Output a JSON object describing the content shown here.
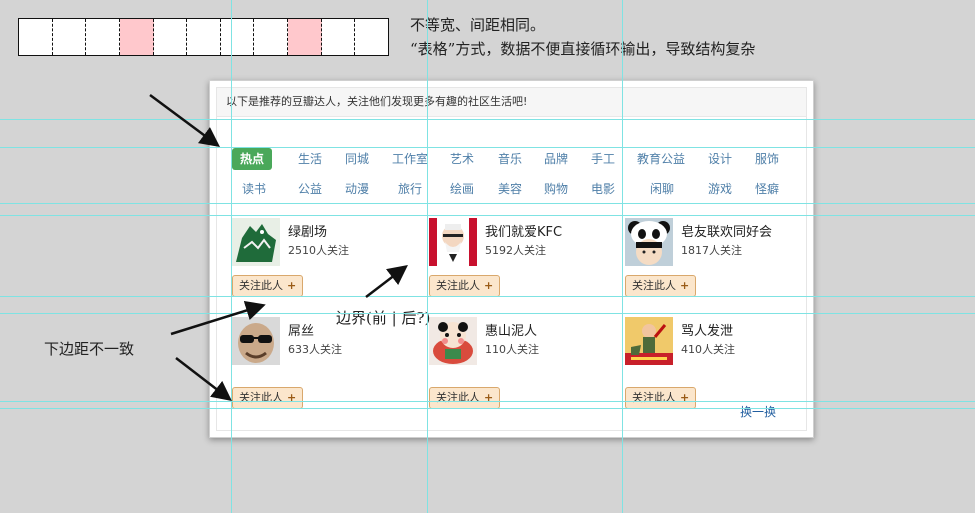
{
  "annotations": {
    "top_note_line1": "不等宽、间距相同。",
    "top_note_line2": "“表格”方式，数据不便直接循环输出，导致结构复杂",
    "left_note": "下边距不一致",
    "border_note": "边界(前 | 后?)"
  },
  "panel": {
    "intro": "以下是推荐的豆瓣达人，关注他们发现更多有趣的社区生活吧!",
    "tags_row1": [
      "热点",
      "生活",
      "同城",
      "工作室",
      "艺术",
      "音乐",
      "品牌",
      "手工",
      "教育公益",
      "设计",
      "服饰"
    ],
    "tags_row2": [
      "读书",
      "公益",
      "动漫",
      "旅行",
      "绘画",
      "美容",
      "购物",
      "电影",
      "闲聊",
      "游戏",
      "怪癖"
    ],
    "users": [
      {
        "name": "绿剧场",
        "count": "2510人关注",
        "avatar": "green-monster-avatar"
      },
      {
        "name": "我们就爱KFC",
        "count": "5192人关注",
        "avatar": "kfc-logo-avatar"
      },
      {
        "name": "皂友联欢同好会",
        "count": "1817人关注",
        "avatar": "panda-hat-avatar"
      },
      {
        "name": "屌丝",
        "count": "633人关注",
        "avatar": "sunglasses-man-avatar"
      },
      {
        "name": "惠山泥人",
        "count": "110人关注",
        "avatar": "clay-figurine-avatar"
      },
      {
        "name": "骂人发泄",
        "count": "410人关注",
        "avatar": "propaganda-poster-avatar"
      }
    ],
    "follow_label": "关注此人",
    "follow_plus": "+",
    "refresh_label": "换一换"
  },
  "colors": {
    "guide": "#7fe3e3",
    "active_tag": "#4aa85a",
    "tag_link": "#4f7fa8",
    "button_bg": "#fbe6cc",
    "pink_cell": "#ffc8cc"
  }
}
